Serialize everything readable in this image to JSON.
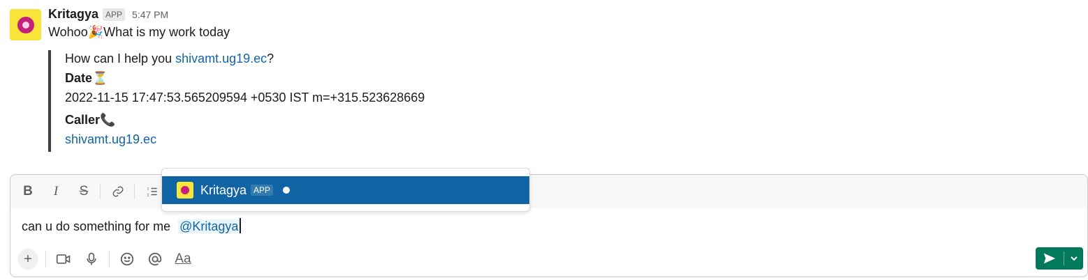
{
  "message": {
    "sender": "Kritagya",
    "badge": "APP",
    "time": "5:47 PM",
    "text": "Wohoo🎉What is my work today",
    "attachment": {
      "greeting_prefix": "How can I help you ",
      "greeting_user": "shivamt.ug19.ec",
      "greeting_suffix": "?",
      "date_label": "Date",
      "date_emoji": "⏳",
      "date_value": "2022-11-15 17:47:53.565209594 +0530 IST m=+315.523628669",
      "caller_label": "Caller",
      "caller_emoji": "📞",
      "caller_value": "shivamt.ug19.ec"
    }
  },
  "composer": {
    "text": "can u do something for me ",
    "mention": "@Kritagya"
  },
  "mention_popup": {
    "name": "Kritagya",
    "badge": "APP"
  },
  "colors": {
    "link": "#1264a3",
    "popup_highlight": "#1164a3",
    "send_button": "#007a5a",
    "avatar_bg": "#f9e43a"
  },
  "icons": {
    "format": [
      "bold-icon",
      "italic-icon",
      "strikethrough-icon",
      "link-icon",
      "numbered-list-icon"
    ],
    "bottom": [
      "plus-icon",
      "video-icon",
      "microphone-icon",
      "emoji-icon",
      "at-icon",
      "text-format-icon"
    ],
    "send": [
      "send-icon",
      "chevron-down-icon"
    ]
  }
}
